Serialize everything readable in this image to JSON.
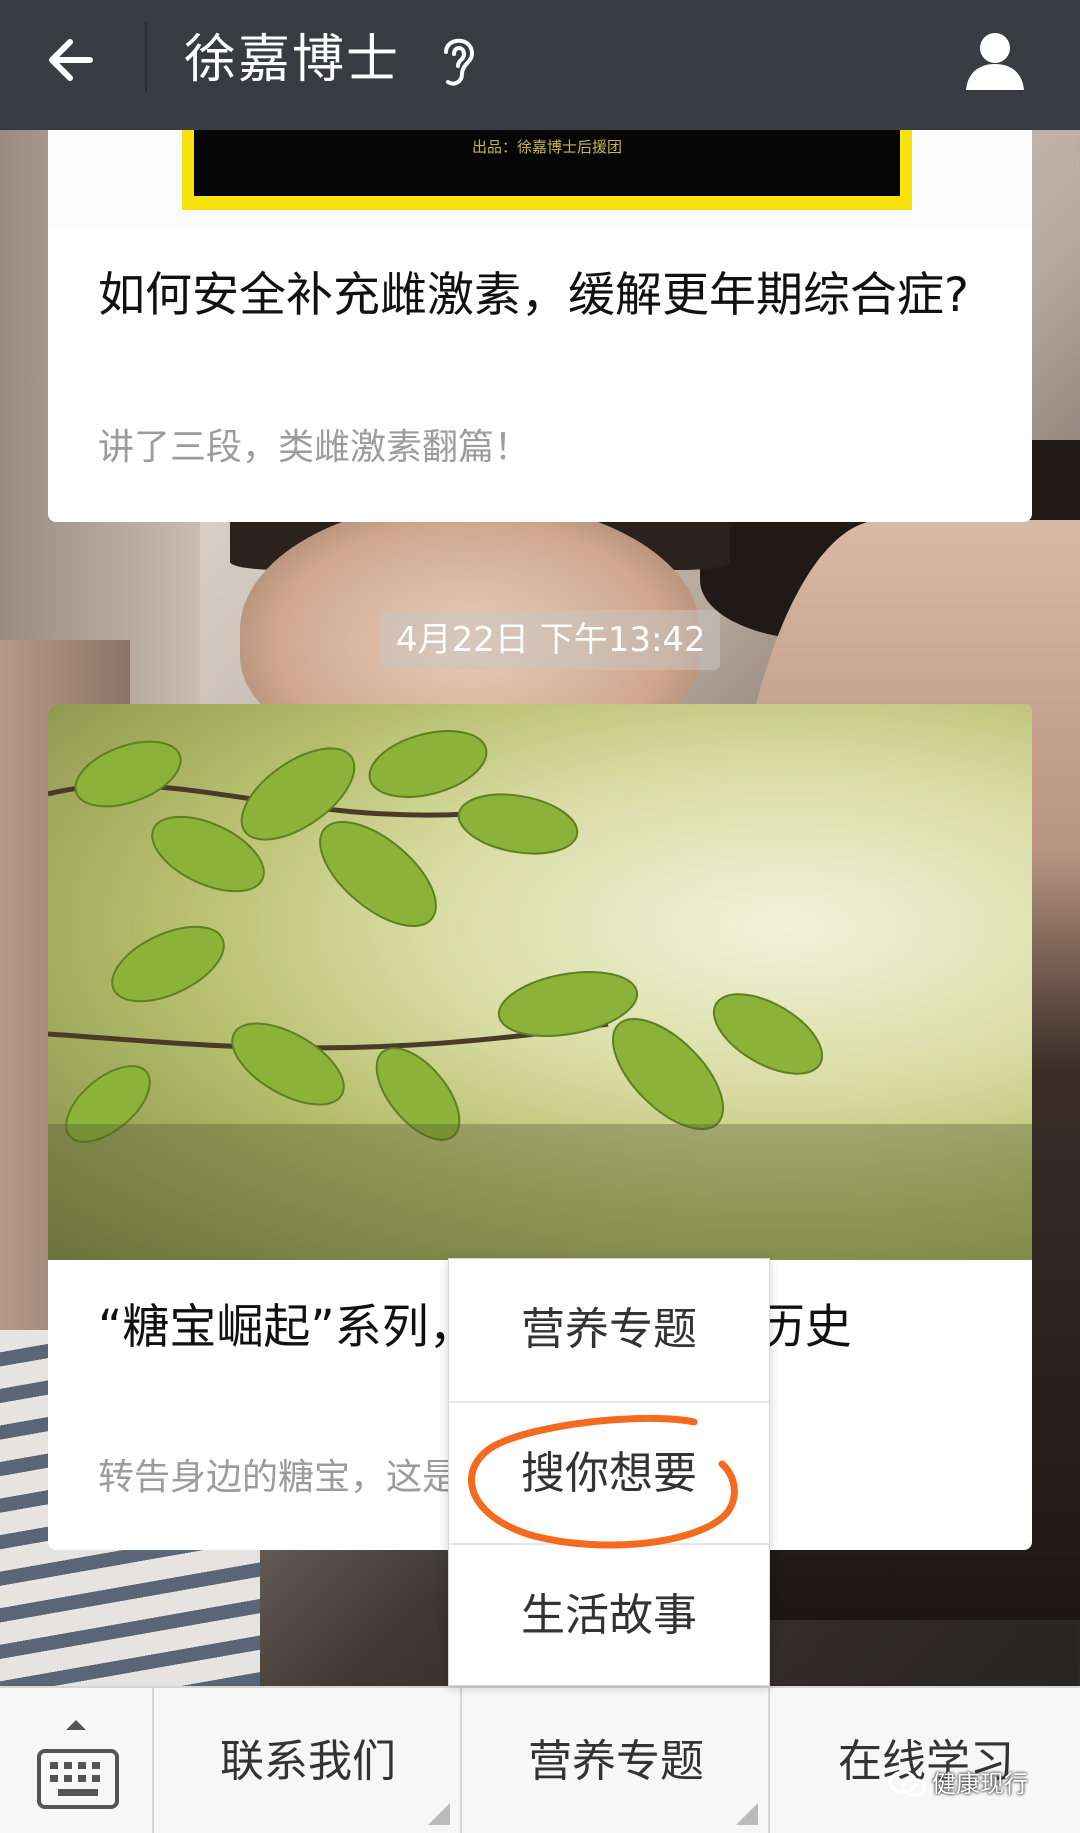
{
  "header": {
    "title": "徐嘉博士",
    "back_icon": "arrow-left-icon",
    "voice_icon": "ear-icon",
    "profile_icon": "person-icon"
  },
  "messages": [
    {
      "thumbnail_credit": "出品：徐嘉博士后援团",
      "title": "如何安全补充雌激素，缓解更年期综合症?",
      "subtitle": "讲了三段，类雌激素翻篇！"
    },
    {
      "timestamp": "4月22日 下午13:42",
      "title": "“糖宝崛起”系列，让糖尿病成为历史",
      "subtitle": "转告身边的糖宝，这是一次健康的约会。"
    }
  ],
  "popup_menu": {
    "items": [
      "营养专题",
      "搜你想要",
      "生活故事"
    ],
    "highlighted_index": 1
  },
  "bottom_menu": {
    "keyboard_icon": "keyboard-icon",
    "items": [
      "联系我们",
      "营养专题",
      "在线学习"
    ]
  },
  "watermark": "健康现行",
  "colors": {
    "topbar": "#383b3f",
    "highlight_circle": "#f46a1e",
    "bottombar": "#f7f7f7"
  }
}
